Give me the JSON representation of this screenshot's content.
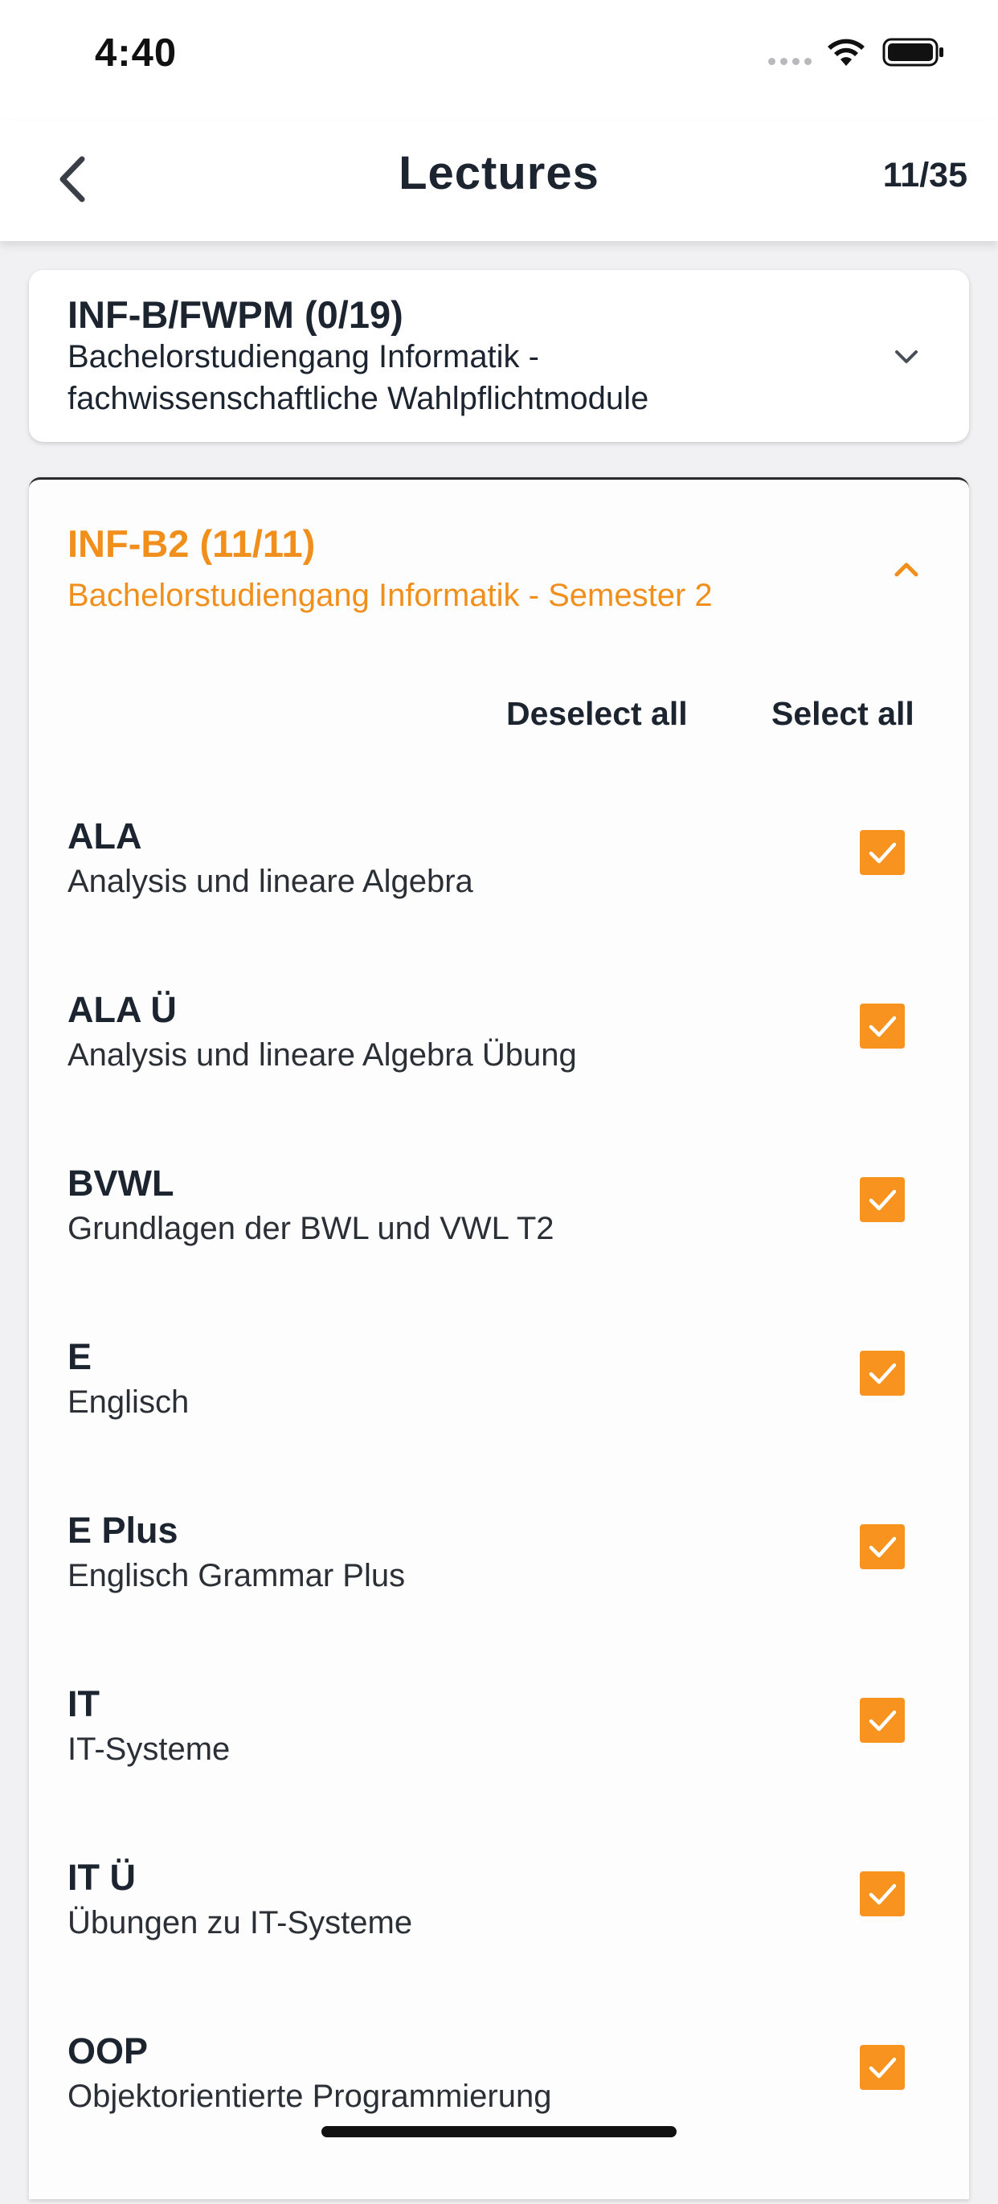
{
  "status_bar": {
    "time": "4:40"
  },
  "nav": {
    "title": "Lectures",
    "counter": "11/35"
  },
  "groups": [
    {
      "code": "INF-B/FWPM (0/19)",
      "description": "Bachelorstudiengang Informatik - fachwissenschaftliche Wahlpflichtmodule",
      "expanded": false
    },
    {
      "code": "INF-B2 (11/11)",
      "description": "Bachelorstudiengang Informatik - Semester 2",
      "expanded": true,
      "deselect_all": "Deselect all",
      "select_all": "Select all",
      "lectures": [
        {
          "code": "ALA",
          "name": "Analysis und lineare Algebra",
          "checked": true
        },
        {
          "code": "ALA Ü",
          "name": "Analysis und lineare Algebra Übung",
          "checked": true
        },
        {
          "code": "BVWL",
          "name": "Grundlagen der BWL und VWL T2",
          "checked": true
        },
        {
          "code": "E",
          "name": "Englisch",
          "checked": true
        },
        {
          "code": "E Plus",
          "name": "Englisch Grammar Plus",
          "checked": true
        },
        {
          "code": "IT",
          "name": "IT-Systeme",
          "checked": true
        },
        {
          "code": "IT Ü",
          "name": "Übungen zu IT-Systeme",
          "checked": true
        },
        {
          "code": "OOP",
          "name": "Objektorientierte Programmierung",
          "checked": true
        }
      ]
    }
  ],
  "colors": {
    "accent": "#f7931e",
    "accent_text": "#f18f1c",
    "text": "#1c2430",
    "background": "#f1f1f3"
  }
}
